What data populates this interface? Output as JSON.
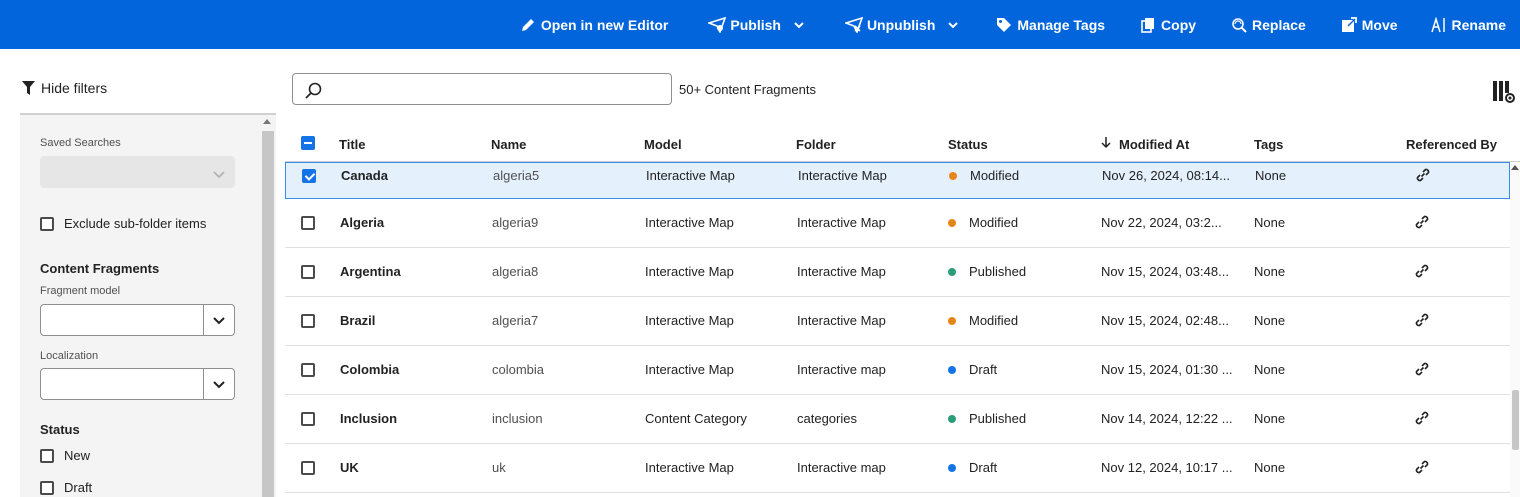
{
  "toolbar": {
    "open_editor": "Open in new Editor",
    "publish": "Publish",
    "unpublish": "Unpublish",
    "manage_tags": "Manage Tags",
    "copy": "Copy",
    "replace": "Replace",
    "move": "Move",
    "rename": "Rename",
    "background_color": "#0265dc"
  },
  "filters": {
    "hide_filters": "Hide filters",
    "saved_searches_label": "Saved Searches",
    "exclude_subfolder": "Exclude sub-folder items",
    "content_fragments_heading": "Content Fragments",
    "fragment_model_label": "Fragment model",
    "localization_label": "Localization",
    "status_heading": "Status",
    "status_options": [
      "New",
      "Draft"
    ]
  },
  "search": {
    "placeholder": "",
    "result_count": "50+ Content Fragments"
  },
  "table": {
    "columns": [
      "Title",
      "Name",
      "Model",
      "Folder",
      "Status",
      "Modified At",
      "Tags",
      "Referenced By"
    ],
    "rows": [
      {
        "title": "Canada",
        "name": "algeria5",
        "model": "Interactive Map",
        "folder": "Interactive Map",
        "status": "Modified",
        "status_color": "#e68619",
        "modified": "Nov 26, 2024, 08:14...",
        "tags": "None",
        "selected": true
      },
      {
        "title": "Algeria",
        "name": "algeria9",
        "model": "Interactive Map",
        "folder": "Interactive Map",
        "status": "Modified",
        "status_color": "#e68619",
        "modified": "Nov 22, 2024, 03:2...",
        "tags": "None",
        "selected": false
      },
      {
        "title": "Argentina",
        "name": "algeria8",
        "model": "Interactive Map",
        "folder": "Interactive Map",
        "status": "Published",
        "status_color": "#2d9d78",
        "modified": "Nov 15, 2024, 03:48...",
        "tags": "None",
        "selected": false
      },
      {
        "title": "Brazil",
        "name": "algeria7",
        "model": "Interactive Map",
        "folder": "Interactive Map",
        "status": "Modified",
        "status_color": "#e68619",
        "modified": "Nov 15, 2024, 02:48...",
        "tags": "None",
        "selected": false
      },
      {
        "title": "Colombia",
        "name": "colombia",
        "model": "Interactive Map",
        "folder": "Interactive map",
        "status": "Draft",
        "status_color": "#1473e6",
        "modified": "Nov 15, 2024, 01:30 ...",
        "tags": "None",
        "selected": false
      },
      {
        "title": "Inclusion",
        "name": "inclusion",
        "model": "Content Category",
        "folder": "categories",
        "status": "Published",
        "status_color": "#2d9d78",
        "modified": "Nov 14, 2024, 12:22 ...",
        "tags": "None",
        "selected": false
      },
      {
        "title": "UK",
        "name": "uk",
        "model": "Interactive Map",
        "folder": "Interactive map",
        "status": "Draft",
        "status_color": "#1473e6",
        "modified": "Nov 12, 2024, 10:17 ...",
        "tags": "None",
        "selected": false
      }
    ]
  }
}
